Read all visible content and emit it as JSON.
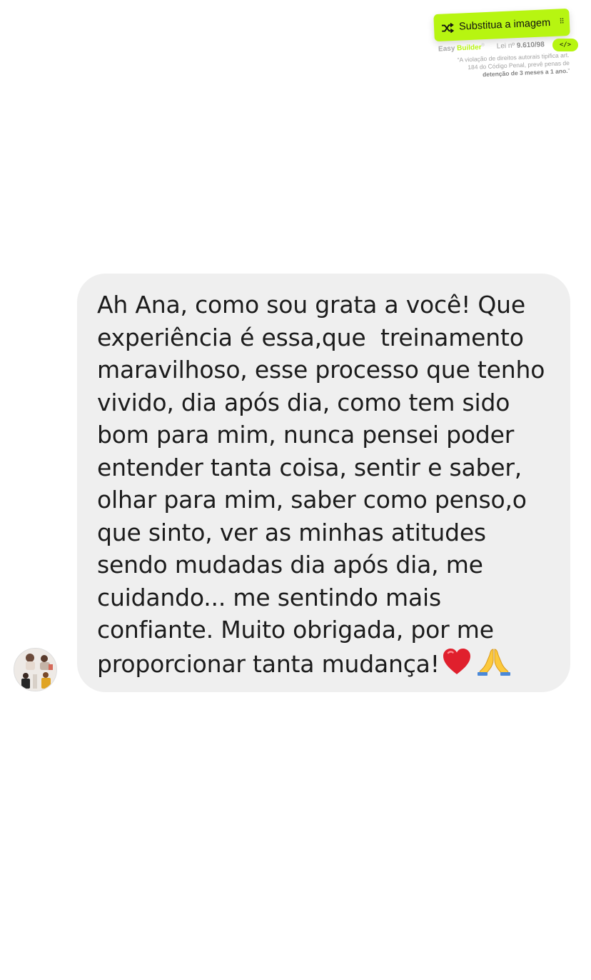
{
  "overlay": {
    "replace_label": "Substitua a imagem",
    "code_label": "</>",
    "brand_easy": "Easy",
    "brand_builder": "Builder",
    "brand_mark": "®",
    "law_prefix": "Lei nº",
    "law_number": "9.610/98",
    "disclaimer_l1": "“A violação de direitos autorais tipifica art.",
    "disclaimer_l2": "184 do Código Penal, prevê penas de",
    "disclaimer_l3": "detenção de 3 meses a 1 ano.",
    "disclaimer_end": "”",
    "accent": "#b7f511"
  },
  "chat": {
    "bubble_color": "#efefef",
    "lines": [
      "Ah Ana, como sou grata a você! Que",
      "experiência é essa,que  treinamento",
      "maravilhoso, esse processo que tenho",
      "vivido, dia após dia, como tem sido",
      "bom para mim, nunca pensei poder",
      "entender tanta coisa, sentir e saber,",
      "olhar para mim, saber como penso,o",
      "que sinto, ver as minhas atitudes",
      "sendo mudadas dia após dia, me",
      "cuidando... me sentindo mais",
      "confiante. Muito obrigada, por me",
      "proporcionar tanta mudança!"
    ],
    "emojis": [
      "heart-emoji",
      "praying-hands-emoji"
    ]
  }
}
